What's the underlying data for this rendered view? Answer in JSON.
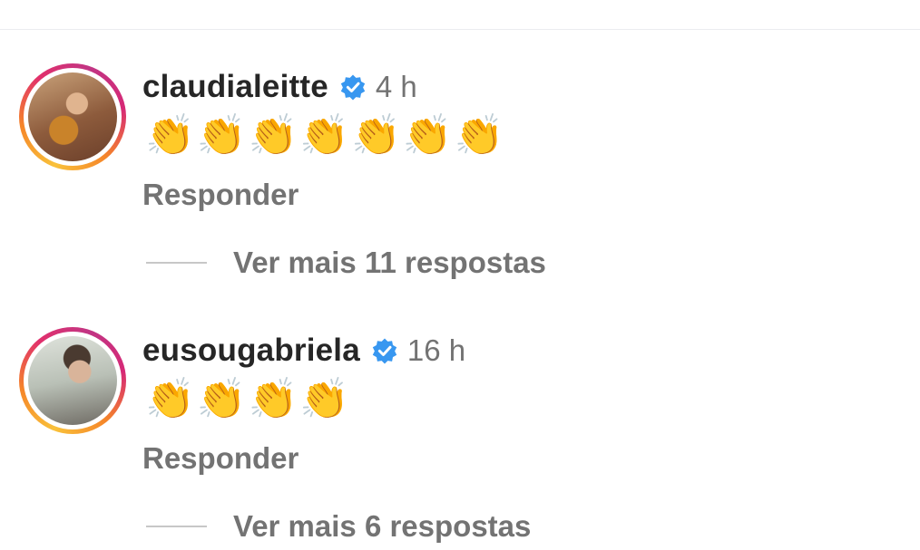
{
  "comments": [
    {
      "username": "claudialeitte",
      "verified": true,
      "time": "4 h",
      "text": "👏👏👏👏👏👏👏",
      "reply_label": "Responder",
      "view_more": "Ver mais 11 respostas"
    },
    {
      "username": "eusougabriela",
      "verified": true,
      "time": "16 h",
      "text": "👏👏👏👏",
      "reply_label": "Responder",
      "view_more": "Ver mais 6 respostas"
    }
  ],
  "colors": {
    "username": "#262626",
    "secondary_text": "#737373",
    "verified_badge": "#3897f0",
    "divider": "#ebecef"
  },
  "icons": {
    "verified": "verified-badge-icon",
    "emoji": "clapping-hands"
  }
}
